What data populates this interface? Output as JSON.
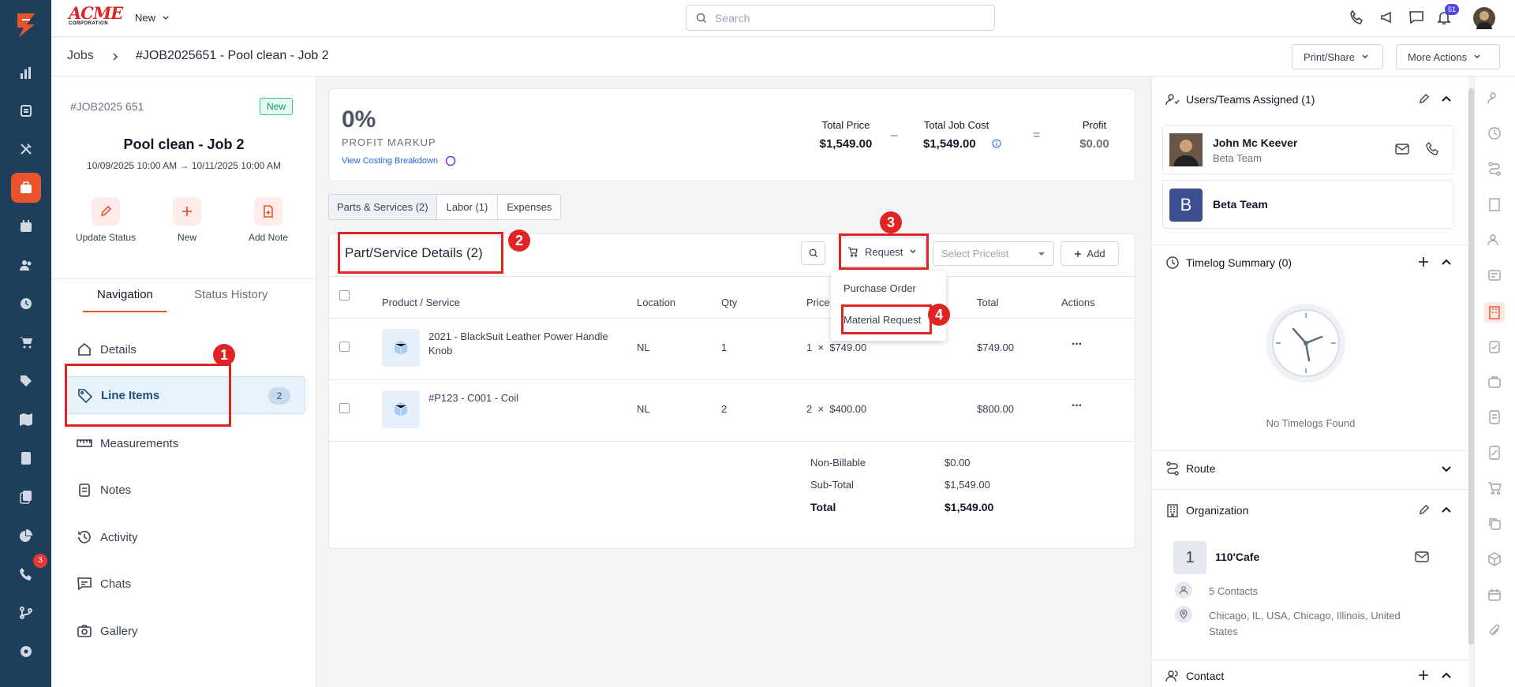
{
  "topbar": {
    "logo_text": "ACME",
    "logo_sub": "CORPORATION",
    "new_label": "New",
    "search_placeholder": "Search",
    "notif_count": "51"
  },
  "leftnav": {
    "badge_count": "3"
  },
  "breadcrumb": {
    "root": "Jobs",
    "current": "#JOB2025651 - Pool clean - Job 2",
    "print_share": "Print/Share",
    "more_actions": "More Actions"
  },
  "job": {
    "number": "#JOB2025 651",
    "status": "New",
    "title": "Pool clean - Job 2",
    "dates": "10/09/2025 10:00 AM → 10/11/2025 10:00 AM",
    "actions": [
      "Update Status",
      "New",
      "Add Note"
    ]
  },
  "nav_tabs": {
    "navigation": "Navigation",
    "status_history": "Status History"
  },
  "nav": {
    "items": [
      {
        "label": "Details"
      },
      {
        "label": "Line Items",
        "count": "2"
      },
      {
        "label": "Measurements"
      },
      {
        "label": "Notes"
      },
      {
        "label": "Activity"
      },
      {
        "label": "Chats"
      },
      {
        "label": "Gallery"
      }
    ]
  },
  "summary": {
    "markup": "0%",
    "markup_label": "PROFIT MARKUP",
    "costing_link": "View Costing Breakdown",
    "total_price_label": "Total Price",
    "total_price": "$1,549.00",
    "minus": "–",
    "total_cost_label": "Total Job Cost",
    "total_cost": "$1,549.00",
    "equals": "=",
    "profit_label": "Profit",
    "profit": "$0.00"
  },
  "tabs": [
    "Parts & Services (2)",
    "Labor (1)",
    "Expenses"
  ],
  "details": {
    "title": "Part/Service Details (2)",
    "request_label": "Request",
    "pricelist_placeholder": "Select Pricelist",
    "add_label": "Add",
    "menu": [
      "Purchase Order",
      "Material Request"
    ],
    "columns": [
      "Product / Service",
      "Location",
      "Qty",
      "Price",
      "Total",
      "Actions"
    ],
    "rows": [
      {
        "name": "2021 - BlackSuit Leather Power Handle Knob",
        "location": "NL",
        "qty": "1",
        "price": "1  ×  $749.00",
        "total": "$749.00"
      },
      {
        "name": "#P123 - C001 - Coil",
        "location": "NL",
        "qty": "2",
        "price": "2  ×  $400.00",
        "total": "$800.00"
      }
    ],
    "totals": [
      {
        "label": "Non-Billable",
        "value": "$0.00"
      },
      {
        "label": "Sub-Total",
        "value": "$1,549.00"
      },
      {
        "label": "Total",
        "value": "$1,549.00"
      }
    ]
  },
  "annotations": [
    "1",
    "2",
    "3",
    "4"
  ],
  "right": {
    "users_title": "Users/Teams Assigned (1)",
    "user_name": "John Mc Keever",
    "user_team": "Beta Team",
    "team_initial": "B",
    "team_name": "Beta Team",
    "timelog_title": "Timelog Summary (0)",
    "no_timelogs": "No Timelogs Found",
    "route_title": "Route",
    "org_title": "Organization",
    "org_initial": "1",
    "org_name": "110'Cafe",
    "contacts": "5 Contacts",
    "address": "Chicago, IL, USA, Chicago, Illinois, United States",
    "contact_title": "Contact"
  }
}
